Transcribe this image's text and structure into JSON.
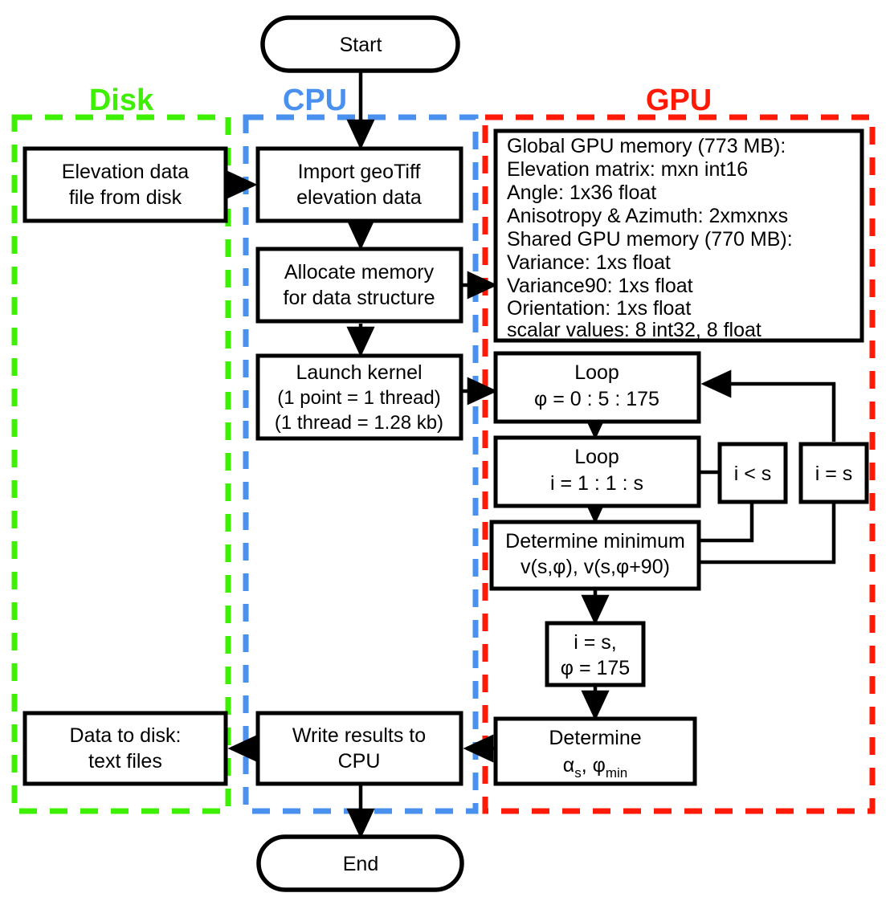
{
  "diagram": {
    "title": "GPU elevation-anisotropy processing flowchart",
    "colors": {
      "disk": "#3cf000",
      "cpu": "#4a90ee",
      "gpu": "#ff1a08",
      "node_stroke": "#000000",
      "node_fill": "#ffffff"
    },
    "groups": [
      {
        "id": "disk",
        "label": "Disk",
        "color": "#3cf000"
      },
      {
        "id": "cpu",
        "label": "CPU",
        "color": "#4a90ee"
      },
      {
        "id": "gpu",
        "label": "GPU",
        "color": "#ff1a08"
      }
    ],
    "terminators": {
      "start": "Start",
      "end": "End"
    },
    "disk_nodes": [
      {
        "id": "elevation-file",
        "lines": [
          "Elevation data",
          "file from disk"
        ]
      },
      {
        "id": "data-to-disk",
        "lines": [
          "Data to disk:",
          "text files"
        ]
      }
    ],
    "cpu_nodes": [
      {
        "id": "import-geotiff",
        "lines": [
          "Import geoTiff",
          "elevation data"
        ]
      },
      {
        "id": "allocate-memory",
        "lines": [
          "Allocate memory",
          "for data structure"
        ]
      },
      {
        "id": "launch-kernel",
        "lines": [
          "Launch kernel",
          "(1 point = 1 thread)",
          "(1 thread = 1.28 kb)"
        ]
      },
      {
        "id": "write-results",
        "lines": [
          "Write results to",
          "CPU"
        ]
      }
    ],
    "gpu_memory": {
      "id": "gpu-memory-spec",
      "lines": [
        "Global GPU memory (773 MB):",
        "Elevation matrix: mxn int16",
        "Angle: 1x36 float",
        "Anisotropy & Azimuth: 2xmxnxs",
        "Shared GPU memory (770 MB):",
        "Variance: 1xs float",
        "Variance90: 1xs float",
        "Orientation: 1xs float",
        "scalar values: 8 int32, 8 float"
      ]
    },
    "gpu_nodes": [
      {
        "id": "loop-phi",
        "lines": [
          "Loop",
          "φ = 0 : 5 : 175"
        ]
      },
      {
        "id": "loop-i",
        "lines": [
          "Loop",
          "i = 1 : 1 : s"
        ]
      },
      {
        "id": "determine-min",
        "lines": [
          "Determine minimum",
          "v(s,φ), v(s,φ+90)"
        ]
      },
      {
        "id": "i-lt-s",
        "lines": [
          "i < s"
        ]
      },
      {
        "id": "i-eq-s",
        "lines": [
          "i = s"
        ]
      },
      {
        "id": "final-indices",
        "lines": [
          "i = s,",
          "φ = 175"
        ]
      },
      {
        "id": "determine-alpha",
        "lines": [
          "Determine"
        ],
        "formula": {
          "alpha": "α",
          "alpha_sub": "s",
          "sep": ", ",
          "phi": "φ",
          "phi_sub": "min"
        }
      }
    ]
  }
}
